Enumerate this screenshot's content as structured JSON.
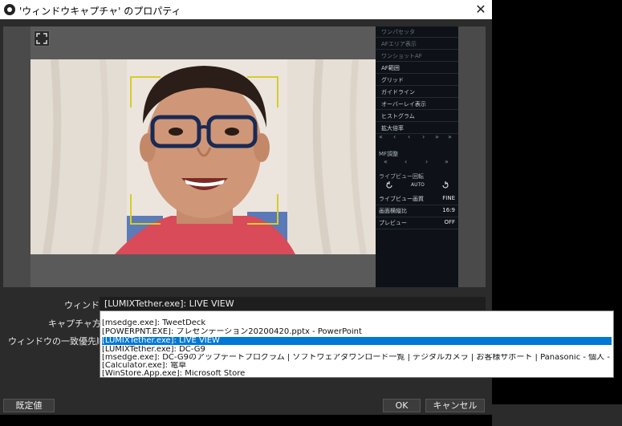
{
  "window": {
    "title": "'ウィンドウキャプチャ' のプロパティ",
    "close_glyph": "✕"
  },
  "side_panel": {
    "menu": [
      {
        "label": "ワンパセッタ",
        "dim": true
      },
      {
        "label": "AFエリア表示",
        "dim": true
      },
      {
        "label": "ワンショットAF",
        "dim": true
      },
      {
        "label": "AF範囲",
        "dim": false
      },
      {
        "label": "グリッド",
        "dim": false
      },
      {
        "label": "ガイドライン",
        "dim": false
      },
      {
        "label": "オーバーレイ表示",
        "dim": false
      },
      {
        "label": "ヒストグラム",
        "dim": false
      },
      {
        "label": "拡大倍率",
        "dim": false
      }
    ],
    "nav_row_1": [
      "«",
      "‹",
      "‹",
      "›",
      "»",
      "»"
    ],
    "mf_label": "MF調整",
    "nav_row_2": [
      "«",
      "‹",
      "›",
      "»"
    ],
    "rotate_label": "ライブビュー回転",
    "rotate_auto": "AUTO",
    "settings": [
      {
        "key": "ライブビュー画質",
        "value": "FINE"
      },
      {
        "key": "画面横縦比",
        "value": "16:9"
      },
      {
        "key": "プレビュー",
        "value": "OFF"
      }
    ]
  },
  "form": {
    "window_label": "ウィンドウ",
    "window_value": "[LUMIXTether.exe]: LIVE VIEW",
    "capture_method_label": "キャプチャ方法",
    "match_priority_label": "ウィンドウの一致優先順位"
  },
  "dropdown": {
    "options": [
      {
        "text": "[msedge.exe]: TweetDeck",
        "selected": false
      },
      {
        "text": "[POWERPNT.EXE]: プレゼンテーション20200420.pptx - PowerPoint",
        "selected": false
      },
      {
        "text": "[LUMIXTether.exe]: LIVE VIEW",
        "selected": true
      },
      {
        "text": "[LUMIXTether.exe]: DC-G9",
        "selected": false
      },
      {
        "text": "[msedge.exe]: DC-G9のアップデートプログラム | ソフトウェアダウンロード一覧 | デジタルカメラ | お客様サポート | Panasonic - 個人 - Microsoft Edge",
        "selected": false
      },
      {
        "text": "[Calculator.exe]: 電卓",
        "selected": false
      },
      {
        "text": "[WinStore.App.exe]: Microsoft Store",
        "selected": false
      }
    ]
  },
  "buttons": {
    "defaults": "既定値",
    "ok": "OK",
    "cancel": "キャンセル"
  }
}
